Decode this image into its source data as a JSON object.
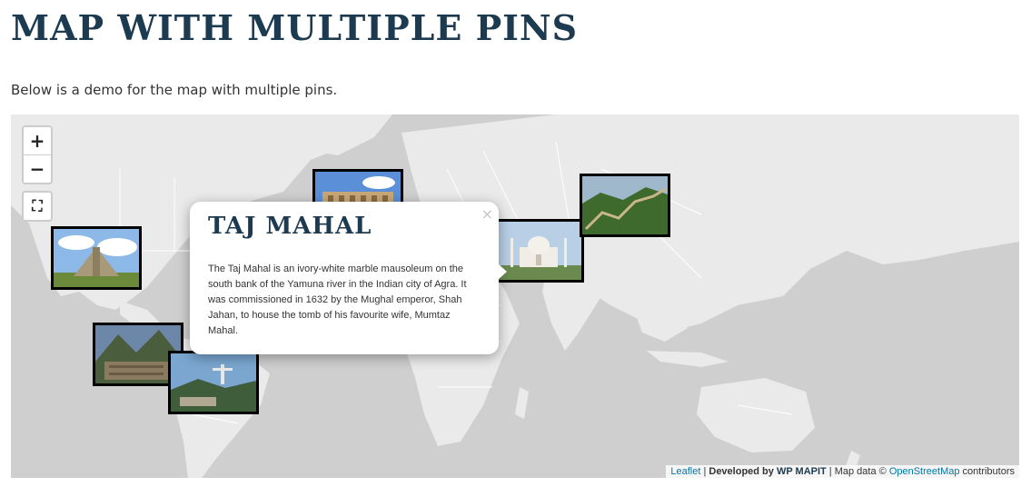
{
  "page": {
    "title": "Map with multiple pins",
    "intro": "Below is a demo for the map with multiple pins."
  },
  "map": {
    "zoom_in_label": "+",
    "zoom_out_label": "−",
    "fullscreen_label": "⛶",
    "pins": [
      {
        "name": "chichen-itza",
        "icon": "pyramid-photo"
      },
      {
        "name": "machu-picchu",
        "icon": "ruins-photo"
      },
      {
        "name": "christ-the-redeemer",
        "icon": "statue-photo"
      },
      {
        "name": "colosseum",
        "icon": "colosseum-photo"
      },
      {
        "name": "taj-mahal",
        "icon": "taj-mahal-photo"
      },
      {
        "name": "great-wall",
        "icon": "great-wall-photo"
      }
    ],
    "popup": {
      "title": "Taj Mahal",
      "close_label": "×",
      "text": "The Taj Mahal is an ivory-white marble mausoleum on the south bank of the Yamuna river in the Indian city of Agra. It was commissioned in 1632 by the Mughal emperor, Shah Jahan, to house the tomb of his favourite wife, Mumtaz Mahal."
    },
    "attribution": {
      "leaflet": "Leaflet",
      "sep1": " | ",
      "developed_by": "Developed by ",
      "wp_mapit": "WP MAPIT",
      "sep2": " | Map data © ",
      "osm": "OpenStreetMap",
      "contributors": " contributors"
    },
    "colors": {
      "land": "#eaeaea",
      "water": "#cfcfcf",
      "borders": "#ffffff",
      "title": "#1c3a50"
    }
  }
}
